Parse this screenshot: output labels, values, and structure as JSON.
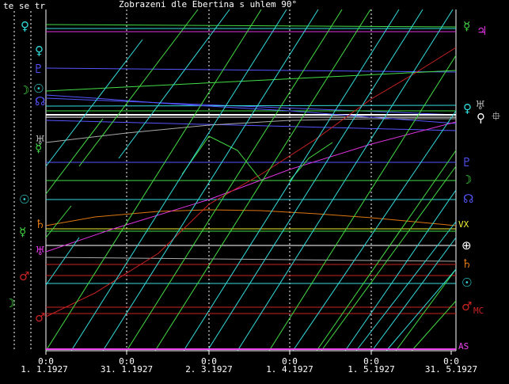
{
  "header": {
    "columns_label": "te se tr",
    "title": "Zobrazeni dle Ebertina s uhlem  90°"
  },
  "colors": {
    "background": "#000000",
    "frame": "#ffffff",
    "text": "#ffffff",
    "green": "#44dd44",
    "cyan": "#33dddd",
    "blue": "#5555ff",
    "magenta": "#dd33dd",
    "red": "#cc2222",
    "orange": "#dd7711",
    "yellow": "#eeee33",
    "pink": "#ee44ee",
    "gray": "#aaaaaa",
    "white": "#ffffff"
  },
  "time_axis": {
    "ticks": [
      {
        "time": "0:0",
        "date": "1. 1.1927"
      },
      {
        "time": "0:0",
        "date": "31. 1.1927"
      },
      {
        "time": "0:0",
        "date": "2. 3.1927"
      },
      {
        "time": "0:0",
        "date": "1. 4.1927"
      },
      {
        "time": "0:0",
        "date": "1. 5.1927"
      },
      {
        "time": "0:0",
        "date": "31. 5.1927"
      }
    ]
  },
  "right_labels": [
    {
      "glyph": "☿",
      "name": "mercury-icon",
      "color": "#44dd44"
    },
    {
      "glyph": "♃",
      "name": "jupiter-icon",
      "color": "#dd33dd"
    },
    {
      "glyph": "♀",
      "name": "venus-icon",
      "color": "#33dddd"
    },
    {
      "glyph": "♅",
      "name": "uranus-icon",
      "color": "#aaaaaa"
    },
    {
      "glyph": "⚲",
      "name": "vertex-symbol-icon",
      "color": "#ffffff"
    },
    {
      "glyph": "⯐",
      "name": "crosshair-icon",
      "color": "#ffffff"
    },
    {
      "glyph": "♇",
      "name": "pluto-icon",
      "color": "#5555ff"
    },
    {
      "glyph": "☽",
      "name": "moon-icon",
      "color": "#44dd44"
    },
    {
      "glyph": "☊",
      "name": "node-icon",
      "color": "#5555ff"
    },
    {
      "text": "VX",
      "name": "vertex-label",
      "color": "#eeee33"
    },
    {
      "glyph": "⊕",
      "name": "part-of-fortune-icon",
      "color": "#ffffff"
    },
    {
      "glyph": "♄",
      "name": "saturn-icon",
      "color": "#dd7711"
    },
    {
      "glyph": "☉",
      "name": "sun-icon",
      "color": "#33dddd"
    },
    {
      "glyph": "♂",
      "name": "mars-icon",
      "color": "#cc2222"
    },
    {
      "text": "MC",
      "name": "mc-label",
      "color": "#cc2222"
    },
    {
      "text": "AS",
      "name": "as-label",
      "color": "#ee44ee"
    }
  ],
  "left_labels": [
    {
      "glyph": "♀",
      "name": "venus-icon",
      "color": "#33dddd"
    },
    {
      "glyph": "♀",
      "name": "venus-icon",
      "color": "#33dddd"
    },
    {
      "glyph": "♇",
      "name": "pluto-icon",
      "color": "#5555ff"
    },
    {
      "glyph": "☽",
      "name": "moon-icon",
      "color": "#44dd44"
    },
    {
      "glyph": "☉",
      "name": "sun-icon",
      "color": "#33dddd"
    },
    {
      "glyph": "☊",
      "name": "node-icon",
      "color": "#5555ff"
    },
    {
      "glyph": "♅",
      "name": "uranus-icon",
      "color": "#aaaaaa"
    },
    {
      "glyph": "☿",
      "name": "mercury-icon",
      "color": "#44dd44"
    },
    {
      "glyph": "☉",
      "name": "sun-icon",
      "color": "#33dddd"
    },
    {
      "glyph": "♄",
      "name": "saturn-icon",
      "color": "#dd7711"
    },
    {
      "glyph": "☿",
      "name": "mercury-icon",
      "color": "#44dd44"
    },
    {
      "glyph": "♅",
      "name": "uranus-icon",
      "color": "#dd33dd"
    },
    {
      "glyph": "♂",
      "name": "mars-icon",
      "color": "#cc2222"
    },
    {
      "glyph": "☽",
      "name": "moon-icon",
      "color": "#44dd44"
    },
    {
      "glyph": "♂",
      "name": "mars-icon",
      "color": "#cc2222"
    }
  ]
}
